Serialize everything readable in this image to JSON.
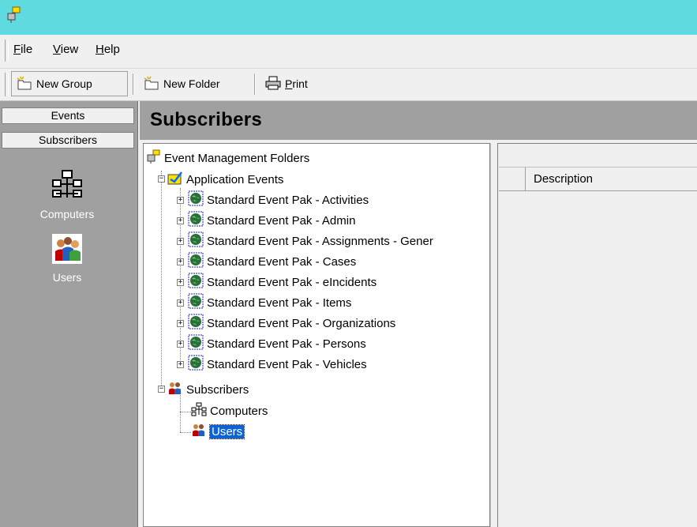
{
  "menu": {
    "items": [
      {
        "accel": "F",
        "rest": "ile"
      },
      {
        "accel": "V",
        "rest": "iew"
      },
      {
        "accel": "H",
        "rest": "elp"
      }
    ]
  },
  "toolbar": {
    "new_group": "New Group",
    "new_folder": "New Folder",
    "print_accel": "P",
    "print_rest": "rint"
  },
  "nav": {
    "tab_events": "Events",
    "tab_subscribers": "Subscribers",
    "computers": "Computers",
    "users": "Users"
  },
  "main": {
    "title": "Subscribers"
  },
  "tree": {
    "root": "Event Management Folders",
    "app_events": "Application Events",
    "paks": [
      "Standard Event Pak - Activities",
      "Standard Event Pak - Admin",
      "Standard Event Pak - Assignments - Gener",
      "Standard Event Pak - Cases",
      "Standard Event Pak - eIncidents",
      "Standard Event Pak - Items",
      "Standard Event Pak - Organizations",
      "Standard Event Pak - Persons",
      "Standard Event Pak - Vehicles"
    ],
    "subscribers": "Subscribers",
    "computers": "Computers",
    "users": "Users",
    "selected": "Users"
  },
  "list": {
    "columns": [
      "",
      "Description"
    ]
  },
  "colors": {
    "titlebar": "#5fdbe0",
    "selection": "#0a64d8",
    "panel_gray": "#a0a0a0"
  }
}
